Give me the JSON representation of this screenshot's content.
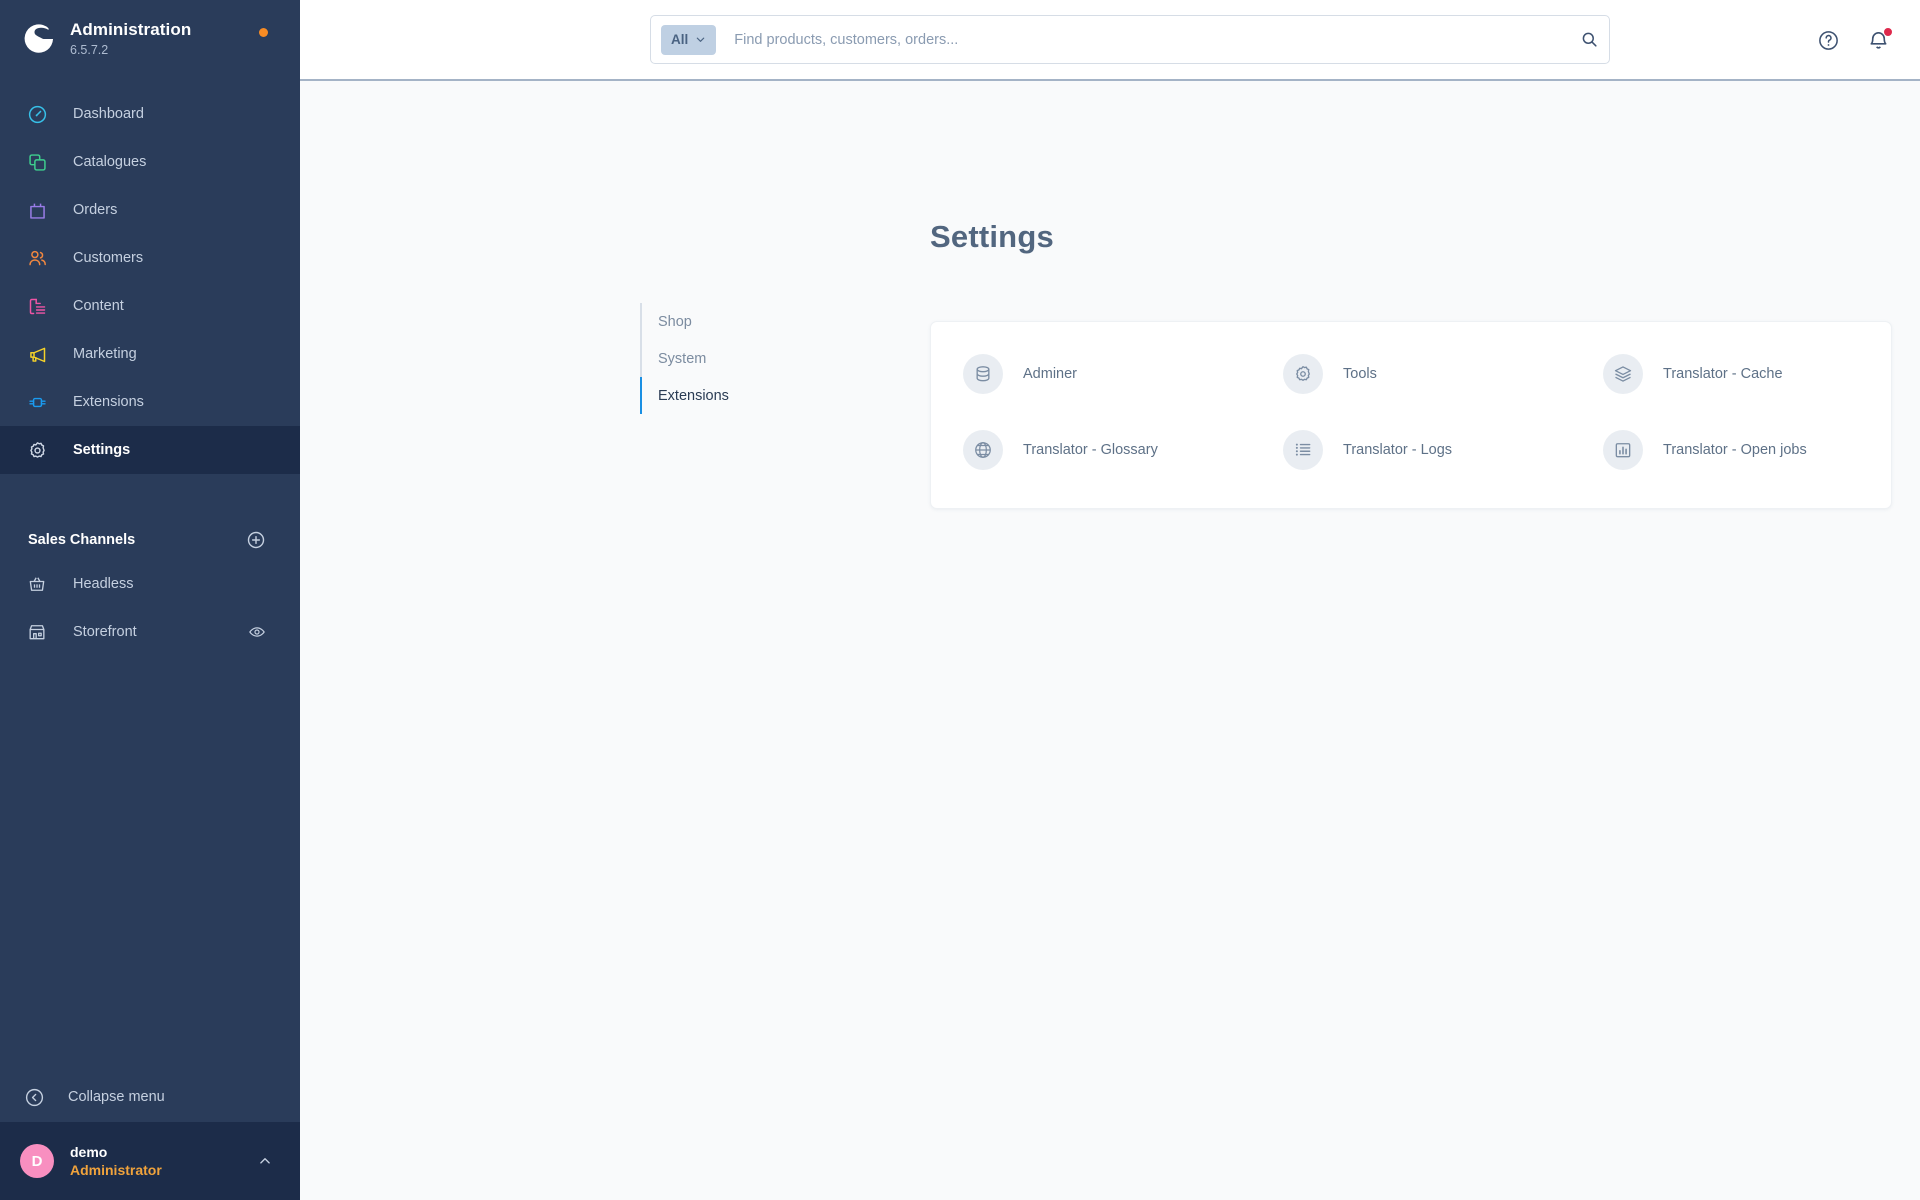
{
  "sidebar": {
    "brand": {
      "title": "Administration",
      "version": "6.5.7.2",
      "logo_icon": "shopware-logo-icon",
      "status_dot_color": "#f88c24"
    },
    "nav_items": [
      {
        "label": "Dashboard",
        "icon": "dashboard-gauge-icon",
        "color": "#37c0e8",
        "active": false
      },
      {
        "label": "Catalogues",
        "icon": "catalogues-copy-icon",
        "color": "#3ecf8e",
        "active": false
      },
      {
        "label": "Orders",
        "icon": "orders-bag-icon",
        "color": "#9a7ce8",
        "active": false
      },
      {
        "label": "Customers",
        "icon": "customers-people-icon",
        "color": "#f1873f",
        "active": false
      },
      {
        "label": "Content",
        "icon": "content-page-icon",
        "color": "#f055a6",
        "active": false
      },
      {
        "label": "Marketing",
        "icon": "marketing-megaphone-icon",
        "color": "#f5d229",
        "active": false
      },
      {
        "label": "Extensions",
        "icon": "extensions-plug-icon",
        "color": "#1a9bf0",
        "active": false
      },
      {
        "label": "Settings",
        "icon": "settings-gear-icon",
        "color": "#c5d0e0",
        "active": true
      }
    ],
    "sales_channels": {
      "title": "Sales Channels",
      "add_icon": "plus-circle-icon",
      "items": [
        {
          "label": "Headless",
          "icon": "basket-icon",
          "trailing_icon": ""
        },
        {
          "label": "Storefront",
          "icon": "storefront-icon",
          "trailing_icon": "eye-icon"
        }
      ]
    },
    "collapse": {
      "label": "Collapse menu",
      "icon": "chevron-left-circle-icon"
    },
    "user": {
      "initial": "D",
      "name": "demo",
      "role": "Administrator",
      "avatar_color": "#f88fc0",
      "role_color": "#f0a33c",
      "chevron_icon": "chevron-up-icon"
    }
  },
  "topbar": {
    "search": {
      "scope_label": "All",
      "scope_chevron_icon": "chevron-down-icon",
      "placeholder": "Find products, customers, orders...",
      "value": "",
      "search_icon": "search-icon"
    },
    "help_icon": "help-circle-icon",
    "notifications_icon": "bell-icon",
    "notifications_dot_color": "#de294c"
  },
  "main": {
    "page_title": "Settings",
    "subnav": [
      {
        "label": "Shop",
        "active": false
      },
      {
        "label": "System",
        "active": false
      },
      {
        "label": "Extensions",
        "active": true
      }
    ],
    "tiles": [
      {
        "label": "Adminer",
        "icon": "database-icon"
      },
      {
        "label": "Tools",
        "icon": "gear-icon"
      },
      {
        "label": "Translator - Cache",
        "icon": "layers-icon"
      },
      {
        "label": "Translator - Glossary",
        "icon": "globe-icon"
      },
      {
        "label": "Translator - Logs",
        "icon": "list-icon"
      },
      {
        "label": "Translator - Open jobs",
        "icon": "bar-chart-icon"
      }
    ]
  }
}
